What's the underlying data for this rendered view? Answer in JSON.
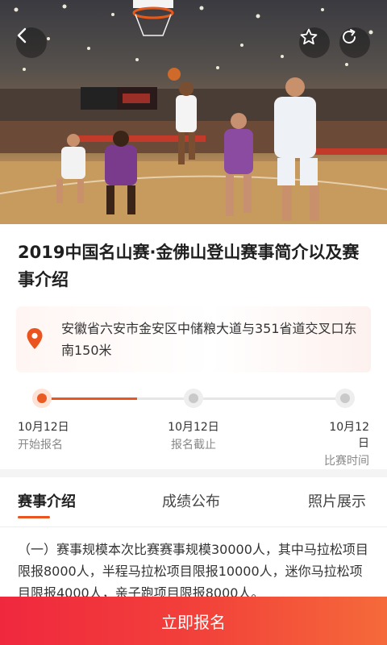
{
  "header": {
    "back_icon": "back-arrow-icon",
    "favorite_icon": "star-icon",
    "share_icon": "refresh-share-icon"
  },
  "event": {
    "title": "2019中国名山赛·金佛山登山赛事简介以及赛事介绍",
    "address": "安徽省六安市金安区中储粮大道与351省道交叉口东南150米"
  },
  "timeline": [
    {
      "date": "10月12日",
      "label": "开始报名",
      "active": true
    },
    {
      "date": "10月12日",
      "label": "报名截止",
      "active": false
    },
    {
      "date": "10月12日",
      "label": "比赛时间",
      "active": false
    }
  ],
  "tabs": [
    {
      "label": "赛事介绍",
      "active": true
    },
    {
      "label": "成绩公布",
      "active": false
    },
    {
      "label": "照片展示",
      "active": false
    }
  ],
  "content": {
    "intro": "（一）赛事规模本次比赛赛事规模30000人，其中马拉松项目限报8000人，半程马拉松项目限报10000人，迷你马拉松项目限报4000人，亲子跑项目限报8000人。"
  },
  "cta": {
    "register_label": "立即报名"
  },
  "colors": {
    "accent": "#e9541f",
    "cta_start": "#f0283e",
    "cta_end": "#f56a3a"
  }
}
